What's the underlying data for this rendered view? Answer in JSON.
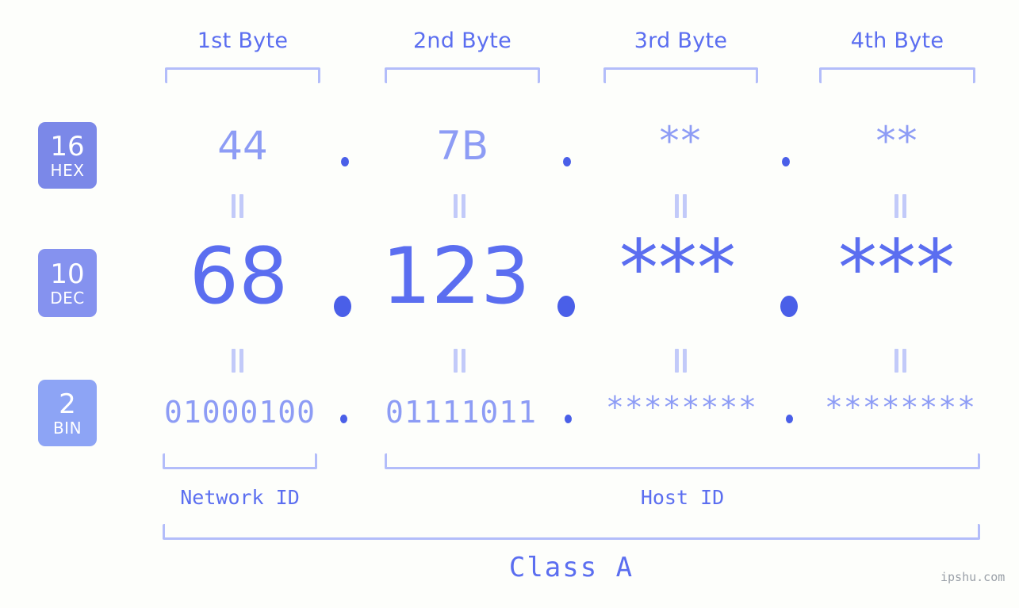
{
  "background_color": "#fdfefb",
  "accent_color": "#5b6ef0",
  "accent_light_color": "#8d9cf5",
  "bracket_color": "#b3bdfa",
  "byte_headers": [
    {
      "label": "1st Byte"
    },
    {
      "label": "2nd Byte"
    },
    {
      "label": "3rd Byte"
    },
    {
      "label": "4th Byte"
    }
  ],
  "bases": [
    {
      "num": "16",
      "abbr": "HEX",
      "color": "#7b88e8"
    },
    {
      "num": "10",
      "abbr": "DEC",
      "color": "#8592ef"
    },
    {
      "num": "2",
      "abbr": "BIN",
      "color": "#8da4f5"
    }
  ],
  "rows": {
    "hex": {
      "values": [
        "44",
        "7B",
        "**",
        "**"
      ],
      "separator": "."
    },
    "dec": {
      "values": [
        "68",
        "123",
        "***",
        "***"
      ],
      "separator": "."
    },
    "bin": {
      "values": [
        "01000100",
        "01111011",
        "********",
        "********"
      ],
      "separator": "."
    }
  },
  "equals_symbol": "=",
  "id_sections": [
    {
      "label": "Network ID"
    },
    {
      "label": "Host ID"
    }
  ],
  "class": {
    "label": "Class A"
  },
  "watermark": {
    "text": "ipshu.com"
  }
}
